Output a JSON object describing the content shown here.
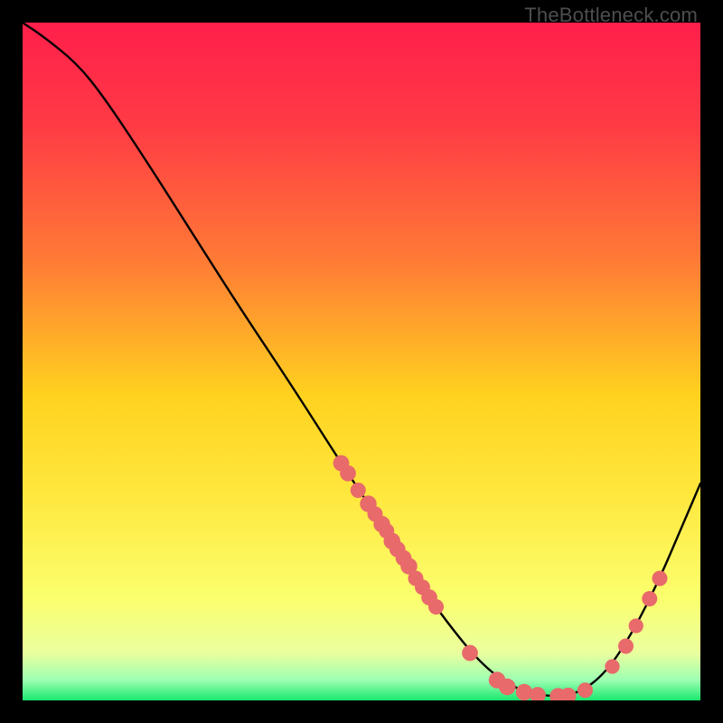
{
  "watermark": "TheBottleneck.com",
  "chart_data": {
    "type": "line",
    "title": "",
    "xlabel": "",
    "ylabel": "",
    "xlim": [
      0,
      100
    ],
    "ylim": [
      0,
      100
    ],
    "gradient_stops": [
      {
        "offset": 0.0,
        "color": "#ff1f4b"
      },
      {
        "offset": 0.15,
        "color": "#ff3a45"
      },
      {
        "offset": 0.35,
        "color": "#ff7a36"
      },
      {
        "offset": 0.55,
        "color": "#ffd21f"
      },
      {
        "offset": 0.7,
        "color": "#ffe83f"
      },
      {
        "offset": 0.85,
        "color": "#fbff6e"
      },
      {
        "offset": 0.93,
        "color": "#eaff9e"
      },
      {
        "offset": 0.97,
        "color": "#9dffb2"
      },
      {
        "offset": 1.0,
        "color": "#19e86e"
      }
    ],
    "curve": [
      {
        "x": 0,
        "y": 100
      },
      {
        "x": 3,
        "y": 98
      },
      {
        "x": 8,
        "y": 94
      },
      {
        "x": 12,
        "y": 89
      },
      {
        "x": 18,
        "y": 80
      },
      {
        "x": 25,
        "y": 69
      },
      {
        "x": 32,
        "y": 58
      },
      {
        "x": 40,
        "y": 46
      },
      {
        "x": 47,
        "y": 35
      },
      {
        "x": 53,
        "y": 26
      },
      {
        "x": 58,
        "y": 18
      },
      {
        "x": 63,
        "y": 11
      },
      {
        "x": 68,
        "y": 5
      },
      {
        "x": 73,
        "y": 1.5
      },
      {
        "x": 78,
        "y": 0.5
      },
      {
        "x": 82,
        "y": 1
      },
      {
        "x": 86,
        "y": 4
      },
      {
        "x": 90,
        "y": 10
      },
      {
        "x": 94,
        "y": 18
      },
      {
        "x": 97,
        "y": 25
      },
      {
        "x": 100,
        "y": 32
      }
    ],
    "markers": [
      {
        "x": 47,
        "y": 35,
        "r": 1.3
      },
      {
        "x": 48,
        "y": 33.5,
        "r": 1.3
      },
      {
        "x": 49.5,
        "y": 31,
        "r": 1.2
      },
      {
        "x": 51,
        "y": 29,
        "r": 1.4
      },
      {
        "x": 52,
        "y": 27.5,
        "r": 1.2
      },
      {
        "x": 53,
        "y": 26,
        "r": 1.4
      },
      {
        "x": 53.7,
        "y": 25,
        "r": 1.2
      },
      {
        "x": 54.5,
        "y": 23.5,
        "r": 1.4
      },
      {
        "x": 55.3,
        "y": 22.3,
        "r": 1.3
      },
      {
        "x": 56.2,
        "y": 21,
        "r": 1.3
      },
      {
        "x": 57,
        "y": 19.8,
        "r": 1.4
      },
      {
        "x": 58,
        "y": 18,
        "r": 1.2
      },
      {
        "x": 59,
        "y": 16.7,
        "r": 1.2
      },
      {
        "x": 60,
        "y": 15.2,
        "r": 1.3
      },
      {
        "x": 61,
        "y": 13.8,
        "r": 1.2
      },
      {
        "x": 66,
        "y": 7,
        "r": 1.3
      },
      {
        "x": 70,
        "y": 3,
        "r": 1.4
      },
      {
        "x": 71.5,
        "y": 2,
        "r": 1.4
      },
      {
        "x": 74,
        "y": 1.2,
        "r": 1.4
      },
      {
        "x": 76,
        "y": 0.8,
        "r": 1.3
      },
      {
        "x": 79,
        "y": 0.6,
        "r": 1.4
      },
      {
        "x": 80.5,
        "y": 0.7,
        "r": 1.3
      },
      {
        "x": 83,
        "y": 1.5,
        "r": 1.2
      },
      {
        "x": 87,
        "y": 5,
        "r": 1.1
      },
      {
        "x": 89,
        "y": 8,
        "r": 1.2
      },
      {
        "x": 90.5,
        "y": 11,
        "r": 1.1
      },
      {
        "x": 92.5,
        "y": 15,
        "r": 1.2
      },
      {
        "x": 94,
        "y": 18,
        "r": 1.2
      }
    ],
    "marker_color": "#e86a6a",
    "line_color": "#000000",
    "line_width": 2.4
  }
}
